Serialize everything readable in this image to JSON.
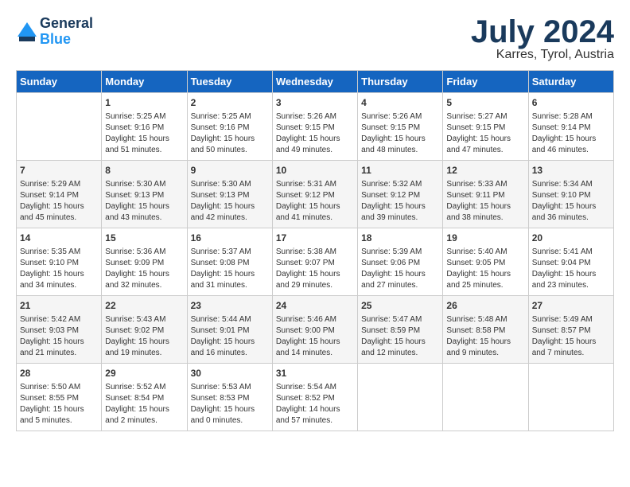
{
  "header": {
    "logo_line1": "General",
    "logo_line2": "Blue",
    "month_title": "July 2024",
    "location": "Karres, Tyrol, Austria"
  },
  "calendar": {
    "days_of_week": [
      "Sunday",
      "Monday",
      "Tuesday",
      "Wednesday",
      "Thursday",
      "Friday",
      "Saturday"
    ],
    "weeks": [
      [
        {
          "day": "",
          "info": ""
        },
        {
          "day": "1",
          "info": "Sunrise: 5:25 AM\nSunset: 9:16 PM\nDaylight: 15 hours\nand 51 minutes."
        },
        {
          "day": "2",
          "info": "Sunrise: 5:25 AM\nSunset: 9:16 PM\nDaylight: 15 hours\nand 50 minutes."
        },
        {
          "day": "3",
          "info": "Sunrise: 5:26 AM\nSunset: 9:15 PM\nDaylight: 15 hours\nand 49 minutes."
        },
        {
          "day": "4",
          "info": "Sunrise: 5:26 AM\nSunset: 9:15 PM\nDaylight: 15 hours\nand 48 minutes."
        },
        {
          "day": "5",
          "info": "Sunrise: 5:27 AM\nSunset: 9:15 PM\nDaylight: 15 hours\nand 47 minutes."
        },
        {
          "day": "6",
          "info": "Sunrise: 5:28 AM\nSunset: 9:14 PM\nDaylight: 15 hours\nand 46 minutes."
        }
      ],
      [
        {
          "day": "7",
          "info": "Sunrise: 5:29 AM\nSunset: 9:14 PM\nDaylight: 15 hours\nand 45 minutes."
        },
        {
          "day": "8",
          "info": "Sunrise: 5:30 AM\nSunset: 9:13 PM\nDaylight: 15 hours\nand 43 minutes."
        },
        {
          "day": "9",
          "info": "Sunrise: 5:30 AM\nSunset: 9:13 PM\nDaylight: 15 hours\nand 42 minutes."
        },
        {
          "day": "10",
          "info": "Sunrise: 5:31 AM\nSunset: 9:12 PM\nDaylight: 15 hours\nand 41 minutes."
        },
        {
          "day": "11",
          "info": "Sunrise: 5:32 AM\nSunset: 9:12 PM\nDaylight: 15 hours\nand 39 minutes."
        },
        {
          "day": "12",
          "info": "Sunrise: 5:33 AM\nSunset: 9:11 PM\nDaylight: 15 hours\nand 38 minutes."
        },
        {
          "day": "13",
          "info": "Sunrise: 5:34 AM\nSunset: 9:10 PM\nDaylight: 15 hours\nand 36 minutes."
        }
      ],
      [
        {
          "day": "14",
          "info": "Sunrise: 5:35 AM\nSunset: 9:10 PM\nDaylight: 15 hours\nand 34 minutes."
        },
        {
          "day": "15",
          "info": "Sunrise: 5:36 AM\nSunset: 9:09 PM\nDaylight: 15 hours\nand 32 minutes."
        },
        {
          "day": "16",
          "info": "Sunrise: 5:37 AM\nSunset: 9:08 PM\nDaylight: 15 hours\nand 31 minutes."
        },
        {
          "day": "17",
          "info": "Sunrise: 5:38 AM\nSunset: 9:07 PM\nDaylight: 15 hours\nand 29 minutes."
        },
        {
          "day": "18",
          "info": "Sunrise: 5:39 AM\nSunset: 9:06 PM\nDaylight: 15 hours\nand 27 minutes."
        },
        {
          "day": "19",
          "info": "Sunrise: 5:40 AM\nSunset: 9:05 PM\nDaylight: 15 hours\nand 25 minutes."
        },
        {
          "day": "20",
          "info": "Sunrise: 5:41 AM\nSunset: 9:04 PM\nDaylight: 15 hours\nand 23 minutes."
        }
      ],
      [
        {
          "day": "21",
          "info": "Sunrise: 5:42 AM\nSunset: 9:03 PM\nDaylight: 15 hours\nand 21 minutes."
        },
        {
          "day": "22",
          "info": "Sunrise: 5:43 AM\nSunset: 9:02 PM\nDaylight: 15 hours\nand 19 minutes."
        },
        {
          "day": "23",
          "info": "Sunrise: 5:44 AM\nSunset: 9:01 PM\nDaylight: 15 hours\nand 16 minutes."
        },
        {
          "day": "24",
          "info": "Sunrise: 5:46 AM\nSunset: 9:00 PM\nDaylight: 15 hours\nand 14 minutes."
        },
        {
          "day": "25",
          "info": "Sunrise: 5:47 AM\nSunset: 8:59 PM\nDaylight: 15 hours\nand 12 minutes."
        },
        {
          "day": "26",
          "info": "Sunrise: 5:48 AM\nSunset: 8:58 PM\nDaylight: 15 hours\nand 9 minutes."
        },
        {
          "day": "27",
          "info": "Sunrise: 5:49 AM\nSunset: 8:57 PM\nDaylight: 15 hours\nand 7 minutes."
        }
      ],
      [
        {
          "day": "28",
          "info": "Sunrise: 5:50 AM\nSunset: 8:55 PM\nDaylight: 15 hours\nand 5 minutes."
        },
        {
          "day": "29",
          "info": "Sunrise: 5:52 AM\nSunset: 8:54 PM\nDaylight: 15 hours\nand 2 minutes."
        },
        {
          "day": "30",
          "info": "Sunrise: 5:53 AM\nSunset: 8:53 PM\nDaylight: 15 hours\nand 0 minutes."
        },
        {
          "day": "31",
          "info": "Sunrise: 5:54 AM\nSunset: 8:52 PM\nDaylight: 14 hours\nand 57 minutes."
        },
        {
          "day": "",
          "info": ""
        },
        {
          "day": "",
          "info": ""
        },
        {
          "day": "",
          "info": ""
        }
      ]
    ]
  }
}
